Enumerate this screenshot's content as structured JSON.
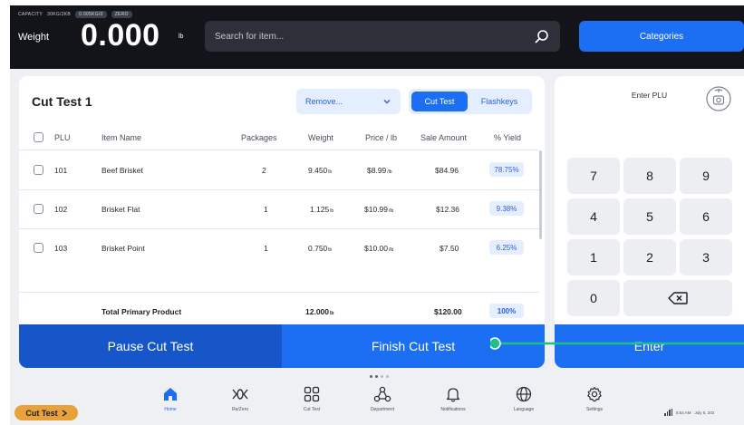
{
  "topbar": {
    "capacity_label": "CAPACITY",
    "capacity_value": "30KG/2KB",
    "capacity_chips": [
      "0.005KG/0",
      "ZERO"
    ],
    "weight_label": "Weight",
    "weight_value": "0.000",
    "weight_unit": "lb",
    "search_placeholder": "Search for item...",
    "categories_label": "Categories"
  },
  "cut_test": {
    "title": "Cut Test 1",
    "remove_dropdown": "Remove...",
    "tabs": [
      "Cut Test",
      "Flashkeys"
    ],
    "columns": [
      "PLU",
      "Item Name",
      "Packages",
      "Weight",
      "Price / lb",
      "Sale Amount",
      "% Yield"
    ],
    "rows": [
      {
        "plu": "101",
        "name": "Beef Brisket",
        "packages": "2",
        "weight": "9.450",
        "weight_unit": "lb",
        "price": "$8.99",
        "price_unit": "/lb",
        "sale": "$84.96",
        "yield": "78.75%"
      },
      {
        "plu": "102",
        "name": "Brisket Flat",
        "packages": "1",
        "weight": "1.125",
        "weight_unit": "lb",
        "price": "$10.99",
        "price_unit": "/lb",
        "sale": "$12.36",
        "yield": "9.38%"
      },
      {
        "plu": "103",
        "name": "Brisket Point",
        "packages": "1",
        "weight": "0.750",
        "weight_unit": "lb",
        "price": "$10.00",
        "price_unit": "/lb",
        "sale": "$7.50",
        "yield": "6.25%"
      }
    ],
    "total": {
      "label": "Total Primary Product",
      "weight": "12.000",
      "weight_unit": "lb",
      "sale": "$120.00",
      "yield": "100%"
    },
    "pause_label": "Pause Cut Test",
    "finish_label": "Finish Cut Test"
  },
  "keypad": {
    "title": "Enter PLU",
    "keys": [
      "7",
      "8",
      "9",
      "4",
      "5",
      "6",
      "1",
      "2",
      "3",
      "0"
    ],
    "enter_label": "Enter"
  },
  "nav": {
    "items": [
      {
        "label": "Home",
        "icon": "home-icon",
        "active": true
      },
      {
        "label": "Re/Zero",
        "icon": "rezero-icon"
      },
      {
        "label": "Cut Test",
        "icon": "grid-icon"
      },
      {
        "label": "Department",
        "icon": "department-icon"
      },
      {
        "label": "Notifications",
        "icon": "bell-icon"
      },
      {
        "label": "Language",
        "icon": "globe-icon"
      },
      {
        "label": "Settings",
        "icon": "gear-icon"
      }
    ]
  },
  "cut_test_pill": "Cut Test",
  "status": {
    "time": "5:54 AM",
    "date": "July 5, 202"
  },
  "colors": {
    "accent": "#1c6ef2",
    "accent_dark": "#1756c9",
    "topbar": "#121419",
    "pill": "#e8a23a",
    "connector": "#1fbf8a"
  }
}
